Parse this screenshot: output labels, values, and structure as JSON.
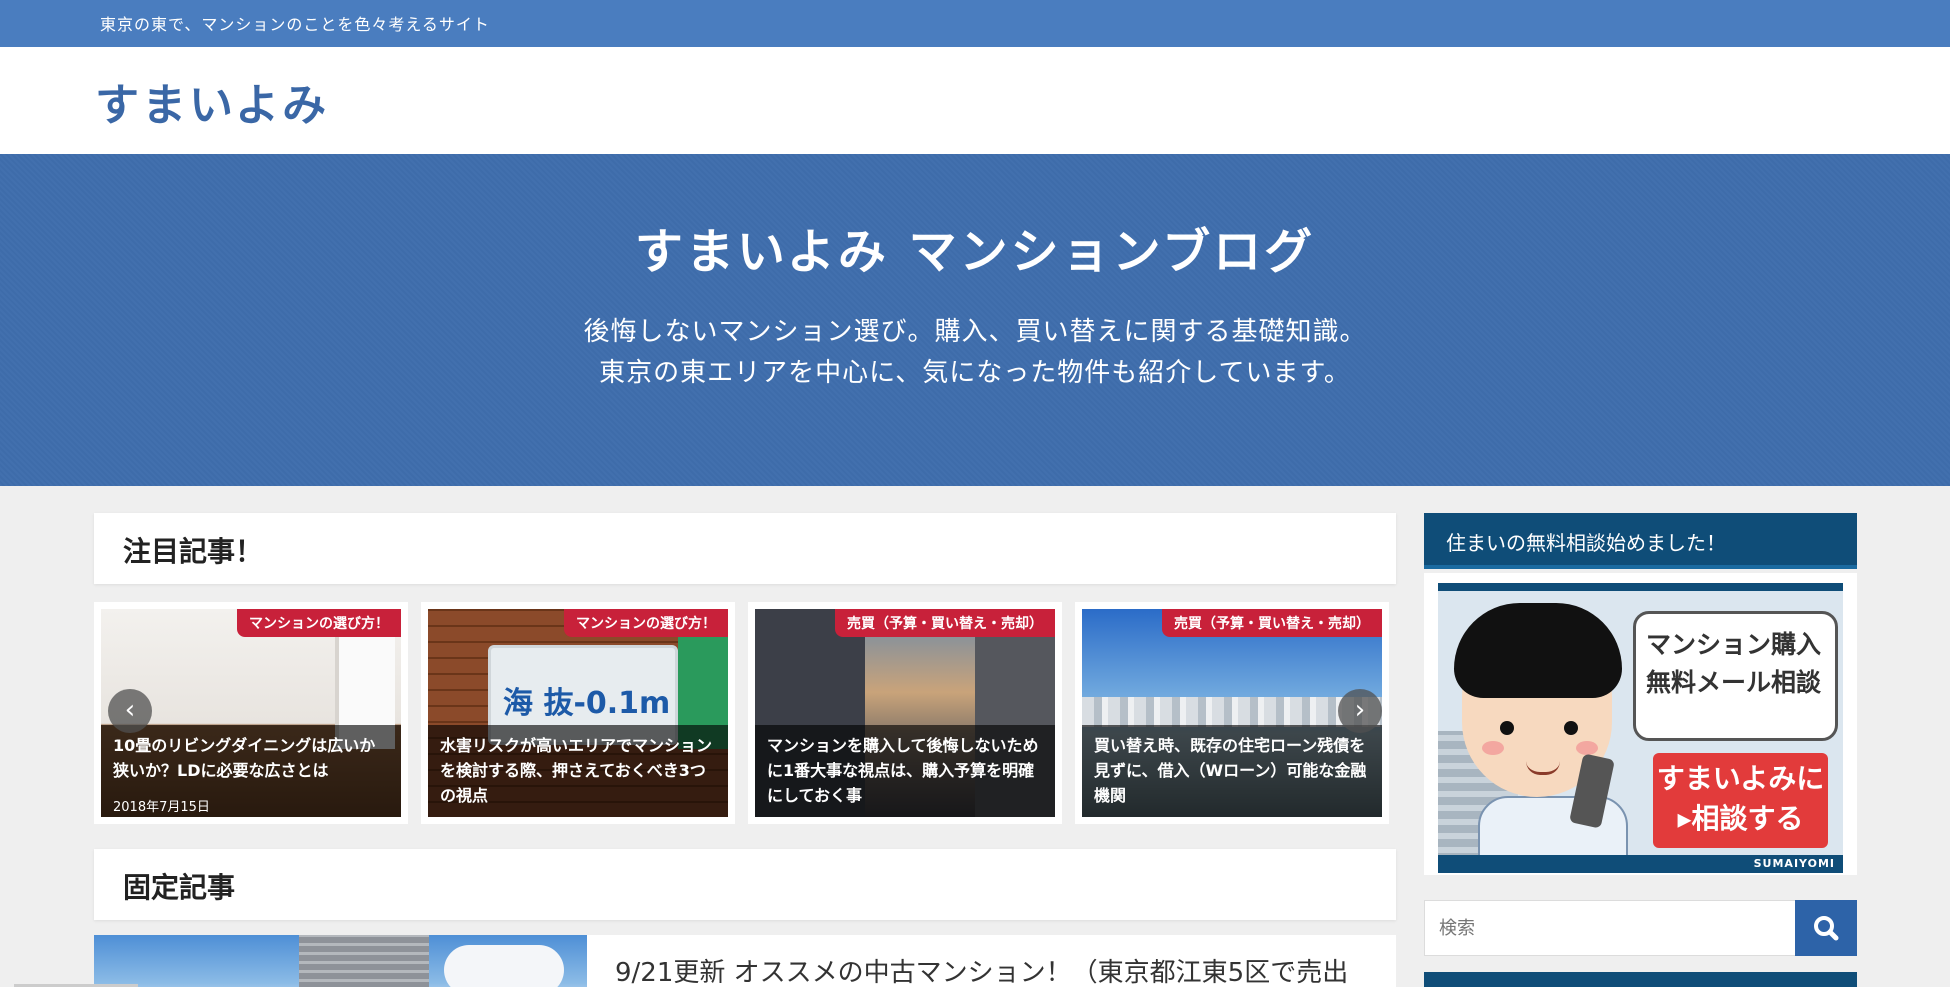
{
  "topbar": {
    "tagline": "東京の東で、マンションのことを色々考えるサイト"
  },
  "header": {
    "logo": "すまいよみ"
  },
  "hero": {
    "title": "すまいよみ マンションブログ",
    "line1": "後悔しないマンション選び。購入、買い替えに関する基礎知識。",
    "line2": "東京の東エリアを中心に、気になった物件も紹介しています。"
  },
  "featured": {
    "heading": "注目記事！",
    "prev_icon": "chevron-left-icon",
    "next_icon": "chevron-right-icon",
    "cards": [
      {
        "category": "マンションの選び方！",
        "title": "10畳のリビングダイニングは広いか狭いか？LDに必要な広さとは",
        "date": "2018年7月15日"
      },
      {
        "category": "マンションの選び方！",
        "title": "水害リスクが高いエリアでマンションを検討する際、押さえておくべき3つの視点",
        "sign_text": "海 抜-0.1m"
      },
      {
        "category": "売買（予算・買い替え・売却）",
        "title": "マンションを購入して後悔しないために1番大事な視点は、購入予算を明確にしておく事"
      },
      {
        "category": "売買（予算・買い替え・売却）",
        "title": "買い替え時、既存の住宅ローン残債を見ずに、借入（Wローン）可能な金融機関"
      }
    ]
  },
  "fixed": {
    "heading": "固定記事",
    "post_title": "9/21更新 オススメの中古マンション！（東京都江東5区で売出"
  },
  "sidebar": {
    "consult_heading": "住まいの無料相談始めました！",
    "banner": {
      "bubble_line1": "マンション購入",
      "bubble_line2": "無料メール相談",
      "cta_line1": "すまいよみに",
      "cta_line2": "▸相談する",
      "brand": "SUMAIYOMI"
    },
    "search": {
      "placeholder": "検索",
      "icon": "search-icon"
    }
  },
  "colors": {
    "topbar": "#4a7dbf",
    "hero": "#3f6ead",
    "logo": "#3a67a6",
    "category_badge": "#c8213a",
    "sidebar_head": "#0f4d78",
    "search_button": "#2d63a8"
  }
}
